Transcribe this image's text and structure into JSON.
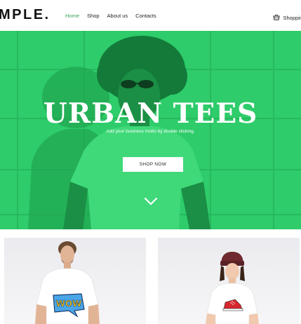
{
  "header": {
    "logo": "MPLE.",
    "nav": [
      {
        "label": "Home",
        "active": true
      },
      {
        "label": "Shop",
        "active": false
      },
      {
        "label": "About us",
        "active": false
      },
      {
        "label": "Contacts",
        "active": false
      }
    ],
    "cart_label": "Shoppin",
    "cart_icon": "basket-icon"
  },
  "hero": {
    "title": "URBAN TEES",
    "subtitle": "Add your business motto by double clicking.",
    "button_label": "SHOP NOW",
    "scroll_icon": "chevron-down-icon"
  },
  "products": [
    {
      "graphic": "WOW"
    },
    {
      "graphic": "sneaker"
    }
  ],
  "colors": {
    "accent": "#3aa55a",
    "hero_green": "#2ecc6a",
    "card_bg": "#efeff2"
  }
}
